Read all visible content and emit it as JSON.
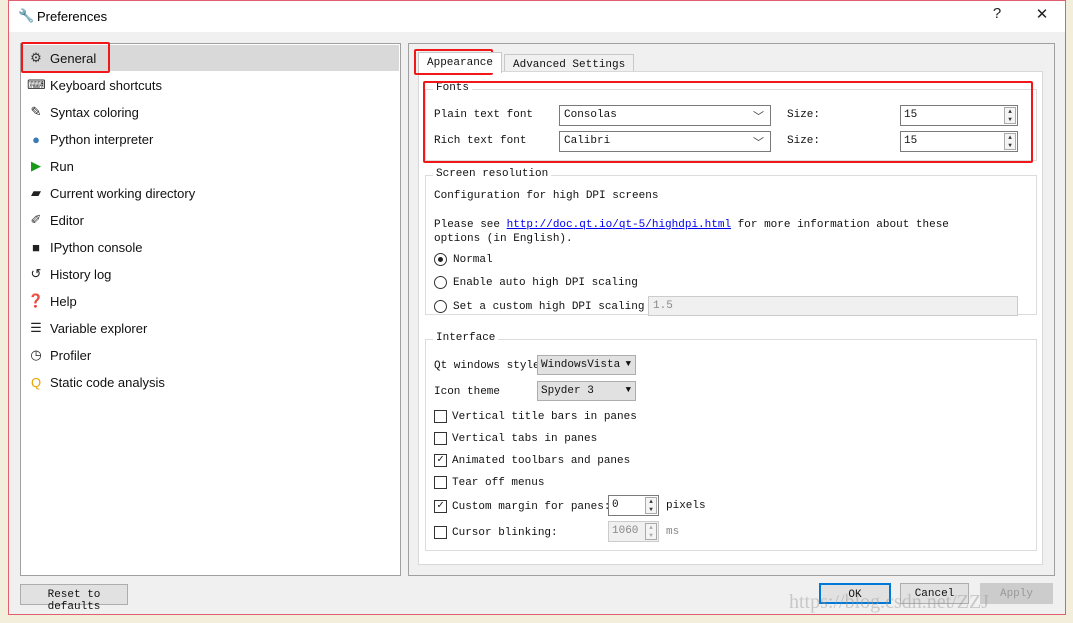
{
  "window": {
    "title": "Preferences",
    "help": "?",
    "close": "✕"
  },
  "sidebar": {
    "items": [
      {
        "label": "General",
        "icon": "gears-icon",
        "glyph": "⚙",
        "color": "#333"
      },
      {
        "label": "Keyboard shortcuts",
        "icon": "keyboard-icon",
        "glyph": "⌨",
        "color": "#333"
      },
      {
        "label": "Syntax coloring",
        "icon": "eyedropper-icon",
        "glyph": "✎",
        "color": "#222"
      },
      {
        "label": "Python interpreter",
        "icon": "python-icon",
        "glyph": "●",
        "color": "#3a7ab8"
      },
      {
        "label": "Run",
        "icon": "play-icon",
        "glyph": "▶",
        "color": "#1a9a1a"
      },
      {
        "label": "Current working directory",
        "icon": "folder-open-icon",
        "glyph": "▰",
        "color": "#222"
      },
      {
        "label": "Editor",
        "icon": "edit-icon",
        "glyph": "✐",
        "color": "#333"
      },
      {
        "label": "IPython console",
        "icon": "ipython-icon",
        "glyph": "■",
        "color": "#222"
      },
      {
        "label": "History log",
        "icon": "history-icon",
        "glyph": "↺",
        "color": "#222"
      },
      {
        "label": "Help",
        "icon": "help-icon",
        "glyph": "❓",
        "color": "#222"
      },
      {
        "label": "Variable explorer",
        "icon": "list-icon",
        "glyph": "☰",
        "color": "#222"
      },
      {
        "label": "Profiler",
        "icon": "clock-icon",
        "glyph": "◷",
        "color": "#222"
      },
      {
        "label": "Static code analysis",
        "icon": "code-analysis-icon",
        "glyph": "Q",
        "color": "#e8a000"
      }
    ],
    "selected": "General"
  },
  "tabs": [
    {
      "label": "Appearance",
      "active": true
    },
    {
      "label": "Advanced Settings",
      "active": false
    }
  ],
  "fonts": {
    "title": "Fonts",
    "plain_label": "Plain text font",
    "plain_value": "Consolas",
    "rich_label": "Rich text font",
    "rich_value": "Calibri",
    "size_label": "Size:",
    "plain_size": "15",
    "rich_size": "15"
  },
  "screen": {
    "title": "Screen resolution",
    "config": "Configuration for high DPI screens",
    "please": "Please see ",
    "link": "http://doc.qt.io/qt-5/highdpi.html",
    "more": " for more information about these options (in English).",
    "options": [
      {
        "label": "Normal",
        "checked": true
      },
      {
        "label": "Enable auto high DPI scaling",
        "checked": false
      },
      {
        "label": "Set a custom high DPI scaling",
        "checked": false
      }
    ],
    "custom_value": "1.5"
  },
  "interface": {
    "title": "Interface",
    "style_label": "Qt windows style",
    "style_value": "WindowsVista",
    "theme_label": "Icon theme",
    "theme_value": "Spyder 3",
    "checks": [
      {
        "label": "Vertical title bars in panes",
        "checked": false
      },
      {
        "label": "Vertical tabs in panes",
        "checked": false
      },
      {
        "label": "Animated toolbars and panes",
        "checked": true
      },
      {
        "label": "Tear off menus",
        "checked": false
      },
      {
        "label": "Custom margin for panes:",
        "checked": true
      },
      {
        "label": "Cursor blinking:",
        "checked": false
      }
    ],
    "margin_value": "0",
    "margin_unit": "pixels",
    "blink_value": "1060",
    "blink_unit": "ms"
  },
  "footer": {
    "reset": "Reset to defaults",
    "ok": "OK",
    "cancel": "Cancel",
    "apply": "Apply"
  },
  "watermark": "https://blog.csdn.net/ZZJ"
}
